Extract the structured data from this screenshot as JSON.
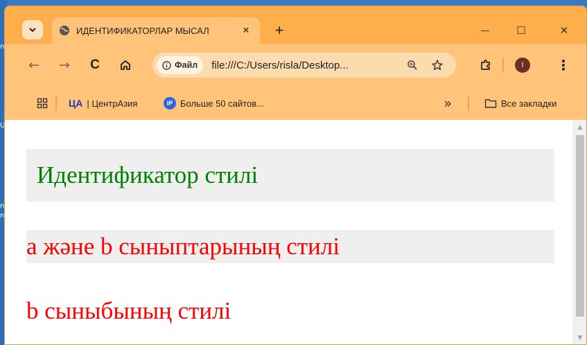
{
  "browser": {
    "tab": {
      "title": "ИДЕНТИФИКАТОРЛАР МЫСАЛ",
      "close_glyph": "✕",
      "icon": "globe-icon"
    },
    "new_tab_glyph": "+",
    "window_controls": {
      "minimize_glyph": "—",
      "maximize_glyph": "☐",
      "close_glyph": "✕"
    },
    "toolbar": {
      "back_glyph": "←",
      "forward_glyph": "→",
      "reload_glyph": "C",
      "home_icon": "home-icon"
    },
    "omnibox": {
      "site_chip_label": "Файл",
      "url": "file:///C:/Users/risla/Desktop..."
    },
    "profile_initial": "I",
    "menu_glyph": "⋮",
    "bookmarks": {
      "apps_icon": "apps-grid-icon",
      "items": [
        {
          "icon_text": "ЦА",
          "label": "| ЦентрАзия"
        },
        {
          "icon_text": "iP",
          "label": "Больше 50 сайтов..."
        }
      ],
      "overflow_glyph": "»",
      "all_bookmarks_label": "Все закладки"
    },
    "colors": {
      "tabstrip": "#ffae4c",
      "toolbar": "#ffc47a",
      "profile": "#6b2f24",
      "bookmark_ca": "#1a34c9",
      "bookmark_ip": "#2a66e0"
    }
  },
  "page": {
    "id_style_text": "Идентификатор стилі",
    "ab_style_text": "а және b сыныптарының стилі",
    "b_style_text": "b сыныбының стилі",
    "colors": {
      "green_text": "#008000",
      "red_text": "#ff0000",
      "box_bg": "#efefef"
    }
  },
  "desktop_edge": {
    "labels": [
      "n",
      "U",
      "nc",
      "ne"
    ]
  }
}
